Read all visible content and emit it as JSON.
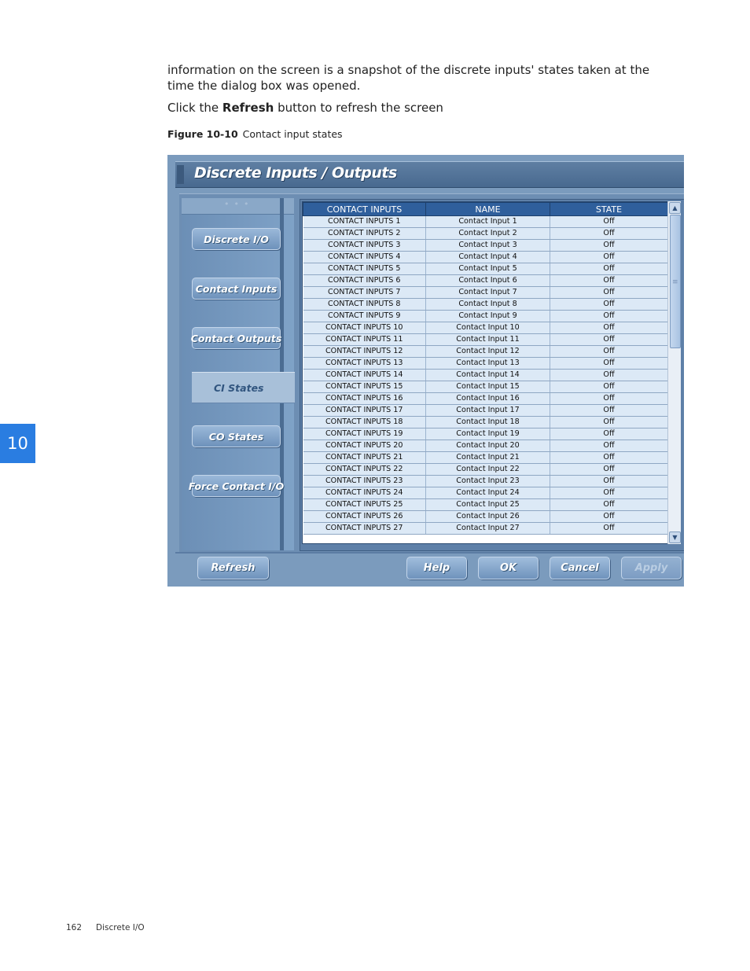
{
  "text": {
    "paragraph1": "information on the screen is a snapshot of the discrete inputs' states taken at the time the dialog box was opened.",
    "paragraph2_pre": "Click the ",
    "paragraph2_bold": "Refresh",
    "paragraph2_post": " button to refresh the screen",
    "figure_label": "Figure 10-10",
    "figure_title": "Contact input states"
  },
  "chapter_tab": "10",
  "footer": {
    "page": "162",
    "section": "Discrete I/O"
  },
  "window": {
    "title": "Discrete Inputs / Outputs",
    "nav": {
      "discrete_io": "Discrete I/O",
      "contact_inputs": "Contact Inputs",
      "contact_outputs": "Contact Outputs",
      "ci_states": "CI States",
      "co_states": "CO States",
      "force_contact_io": "Force Contact I/O"
    },
    "grid": {
      "headers": [
        "CONTACT INPUTS",
        "NAME",
        "STATE"
      ],
      "rows": [
        [
          "CONTACT INPUTS 1",
          "Contact Input 1",
          "Off"
        ],
        [
          "CONTACT INPUTS 2",
          "Contact Input 2",
          "Off"
        ],
        [
          "CONTACT INPUTS 3",
          "Contact Input 3",
          "Off"
        ],
        [
          "CONTACT INPUTS 4",
          "Contact Input 4",
          "Off"
        ],
        [
          "CONTACT INPUTS 5",
          "Contact Input 5",
          "Off"
        ],
        [
          "CONTACT INPUTS 6",
          "Contact Input 6",
          "Off"
        ],
        [
          "CONTACT INPUTS 7",
          "Contact Input 7",
          "Off"
        ],
        [
          "CONTACT INPUTS 8",
          "Contact Input 8",
          "Off"
        ],
        [
          "CONTACT INPUTS 9",
          "Contact Input 9",
          "Off"
        ],
        [
          "CONTACT INPUTS 10",
          "Contact Input 10",
          "Off"
        ],
        [
          "CONTACT INPUTS 11",
          "Contact Input 11",
          "Off"
        ],
        [
          "CONTACT INPUTS 12",
          "Contact Input 12",
          "Off"
        ],
        [
          "CONTACT INPUTS 13",
          "Contact Input 13",
          "Off"
        ],
        [
          "CONTACT INPUTS 14",
          "Contact Input 14",
          "Off"
        ],
        [
          "CONTACT INPUTS 15",
          "Contact Input 15",
          "Off"
        ],
        [
          "CONTACT INPUTS 16",
          "Contact Input 16",
          "Off"
        ],
        [
          "CONTACT INPUTS 17",
          "Contact Input 17",
          "Off"
        ],
        [
          "CONTACT INPUTS 18",
          "Contact Input 18",
          "Off"
        ],
        [
          "CONTACT INPUTS 19",
          "Contact Input 19",
          "Off"
        ],
        [
          "CONTACT INPUTS 20",
          "Contact Input 20",
          "Off"
        ],
        [
          "CONTACT INPUTS 21",
          "Contact Input 21",
          "Off"
        ],
        [
          "CONTACT INPUTS 22",
          "Contact Input 22",
          "Off"
        ],
        [
          "CONTACT INPUTS 23",
          "Contact Input 23",
          "Off"
        ],
        [
          "CONTACT INPUTS 24",
          "Contact Input 24",
          "Off"
        ],
        [
          "CONTACT INPUTS 25",
          "Contact Input 25",
          "Off"
        ],
        [
          "CONTACT INPUTS 26",
          "Contact Input 26",
          "Off"
        ],
        [
          "CONTACT INPUTS 27",
          "Contact Input 27",
          "Off"
        ]
      ],
      "scroll_arrow_up": "▲",
      "scroll_arrow_down": "▼"
    },
    "buttons": {
      "refresh": "Refresh",
      "help": "Help",
      "ok": "OK",
      "cancel": "Cancel",
      "apply": "Apply"
    }
  }
}
